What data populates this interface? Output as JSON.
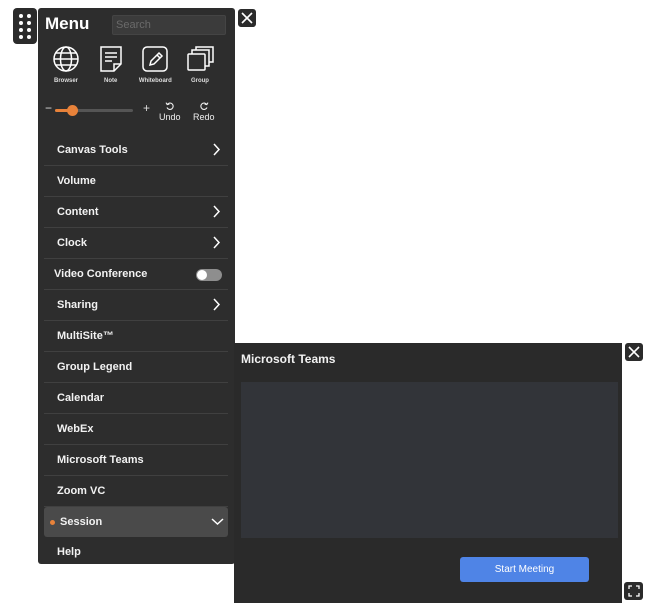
{
  "menu": {
    "title": "Menu",
    "search_placeholder": "Search",
    "tools": [
      {
        "label": "Browser",
        "icon": "globe-icon"
      },
      {
        "label": "Note",
        "icon": "note-icon"
      },
      {
        "label": "Whiteboard",
        "icon": "whiteboard-pencil-icon"
      },
      {
        "label": "Group",
        "icon": "group-stack-icon"
      }
    ],
    "zoom": {
      "minus": "−",
      "plus": "+",
      "level": 0.22
    },
    "undo_label": "Undo",
    "redo_label": "Redo",
    "items": [
      {
        "label": "Canvas Tools",
        "chevron": "right"
      },
      {
        "label": "Volume"
      },
      {
        "label": "Content",
        "chevron": "right"
      },
      {
        "label": "Clock",
        "chevron": "right"
      },
      {
        "label": "Video Conference",
        "toggle": false
      },
      {
        "label": "Sharing",
        "chevron": "right"
      },
      {
        "label": "MultiSite™"
      },
      {
        "label": "Group Legend"
      },
      {
        "label": "Calendar"
      },
      {
        "label": "WebEx"
      },
      {
        "label": "Microsoft Teams"
      },
      {
        "label": "Zoom VC"
      },
      {
        "label": "Session",
        "chevron": "down",
        "active_dot": true,
        "highlighted": true
      },
      {
        "label": "Help"
      }
    ]
  },
  "teams": {
    "title": "Microsoft Teams",
    "start_button": "Start Meeting"
  },
  "colors": {
    "accent": "#e8823a",
    "button_blue": "#4f84e6",
    "panel_bg": "#2d2d2d"
  }
}
